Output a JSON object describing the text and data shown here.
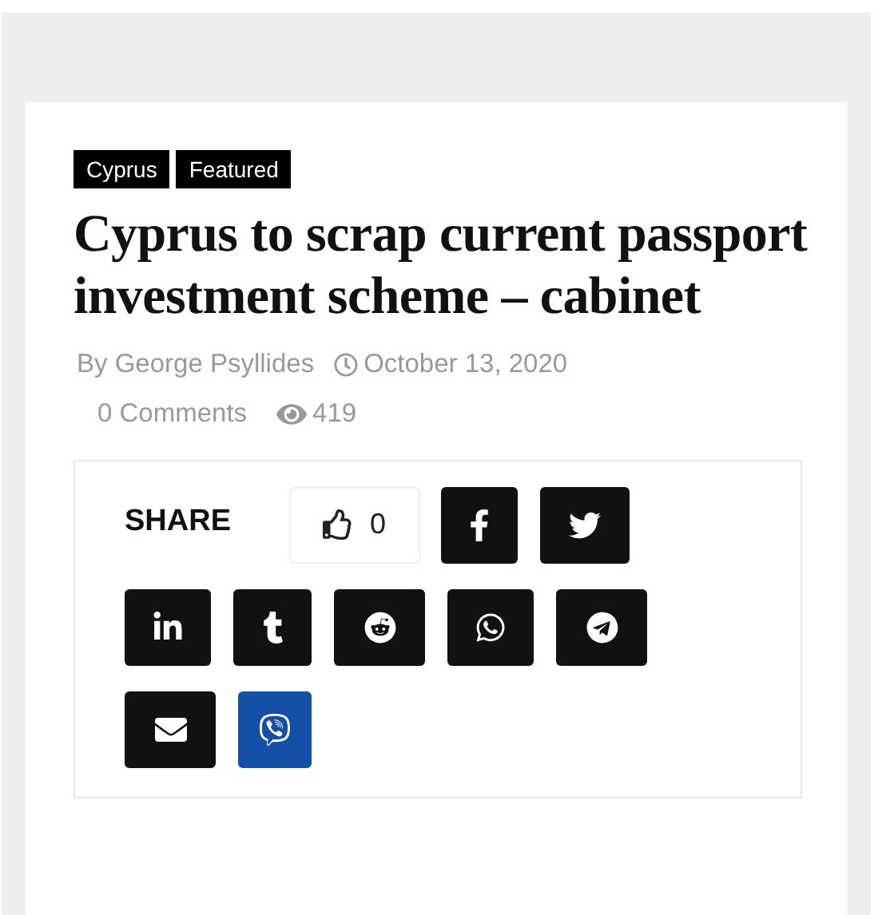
{
  "tags": [
    "Cyprus",
    "Featured"
  ],
  "title": "Cyprus to scrap current passport investment scheme – cabinet",
  "meta": {
    "author": "By George Psyllides",
    "date": "October 13, 2020",
    "comments": "0 Comments",
    "views": "419"
  },
  "share": {
    "label": "SHARE",
    "likes": "0",
    "buttons": [
      {
        "kind": "facebook"
      },
      {
        "kind": "twitter"
      },
      {
        "kind": "linkedin"
      },
      {
        "kind": "tumblr"
      },
      {
        "kind": "reddit"
      },
      {
        "kind": "whatsapp"
      },
      {
        "kind": "telegram"
      },
      {
        "kind": "email"
      },
      {
        "kind": "viber"
      }
    ]
  }
}
